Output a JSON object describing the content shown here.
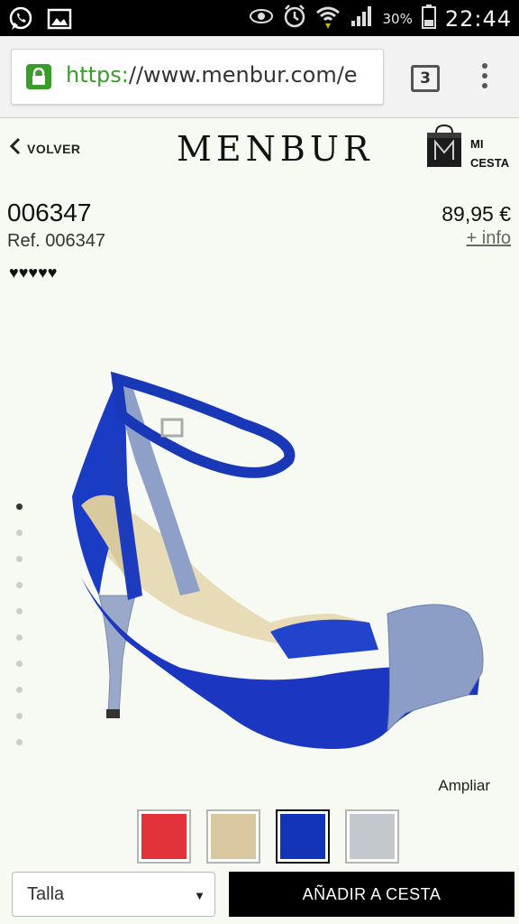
{
  "status_bar": {
    "battery": "30%",
    "time": "22:44"
  },
  "browser": {
    "url_scheme": "https:",
    "url_rest": "//www.menbur.com/e",
    "tab_count": "3"
  },
  "header": {
    "back_label": "VOLVER",
    "logo": "MENBUR",
    "cart_label_line1": "MI",
    "cart_label_line2": "CESTA"
  },
  "product": {
    "title": "006347",
    "ref": "Ref. 006347",
    "rating_display": "♥♥♥♥♥",
    "price": "89,95 €",
    "info_link": "+ info"
  },
  "gallery": {
    "image_count": 10,
    "active_index": 0,
    "zoom_label": "Ampliar"
  },
  "colors": {
    "options": [
      {
        "name": "red",
        "color": "#e2333b"
      },
      {
        "name": "gold",
        "color": "#d9c7a0"
      },
      {
        "name": "blue",
        "color": "#1434b8"
      },
      {
        "name": "silver",
        "color": "#c3c8cc"
      }
    ],
    "selected_index": 2
  },
  "actions": {
    "size_select_label": "Talla",
    "add_to_cart_label": "AÑADIR A CESTA"
  },
  "theme": {
    "accent_green": "#3a9d2b",
    "shoe_blue": "#1434b8"
  }
}
